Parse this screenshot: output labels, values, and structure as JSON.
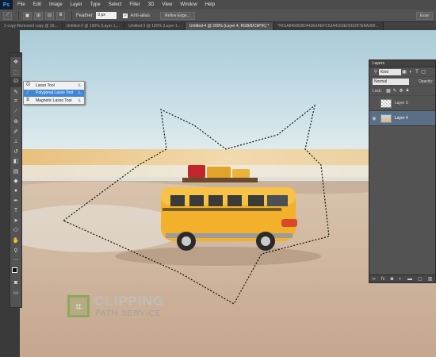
{
  "menubar": {
    "logo": "Ps",
    "items": [
      "File",
      "Edit",
      "Image",
      "Layer",
      "Type",
      "Select",
      "Filter",
      "3D",
      "View",
      "Window",
      "Help"
    ]
  },
  "options": {
    "feather_label": "Feather:",
    "feather_value": "0 px",
    "antialias_label": "Anti-alias",
    "refine_edge": "Refine Edge...",
    "workspace": "Esse"
  },
  "tabs": [
    {
      "label": "2-copy-Removed copy @ 33...",
      "active": false
    },
    {
      "label": "Untitled-2 @ 100% (Layer 1,...",
      "active": false
    },
    {
      "label": "Untitled-3 @ 100% (Layer 1...",
      "active": false
    },
    {
      "label": "Untitled-4 @ 200% (Layer 4, RGB/8/CMYK) *",
      "active": true
    },
    {
      "label": "*R01A8468D8D443E0AEFC62A4163E02EDB7E8A399...",
      "active": false
    }
  ],
  "flyout": {
    "items": [
      {
        "label": "Lasso Tool",
        "shortcut": "L",
        "icon": "lasso-icon"
      },
      {
        "label": "Polygonal Lasso Tool",
        "shortcut": "L",
        "icon": "polygonal-lasso-icon"
      },
      {
        "label": "Magnetic Lasso Tool",
        "shortcut": "L",
        "icon": "magnetic-lasso-icon"
      }
    ]
  },
  "layers_panel": {
    "title": "Layers",
    "filter_kind": "Kind",
    "blend_mode": "Normal",
    "opacity_label": "Opacity:",
    "lock_label": "Lock:",
    "layers": [
      {
        "name": "Layer 3",
        "visible": false,
        "active": false
      },
      {
        "name": "Layer 4",
        "visible": true,
        "active": true
      }
    ]
  },
  "watermark": {
    "line1": "CLIPPING",
    "line2": "PATH SERVICE"
  },
  "colors": {
    "accent": "#3f86d6",
    "bus": "#f3b02a",
    "sky": "#b9d4e0",
    "sand": "#d4bba4"
  }
}
